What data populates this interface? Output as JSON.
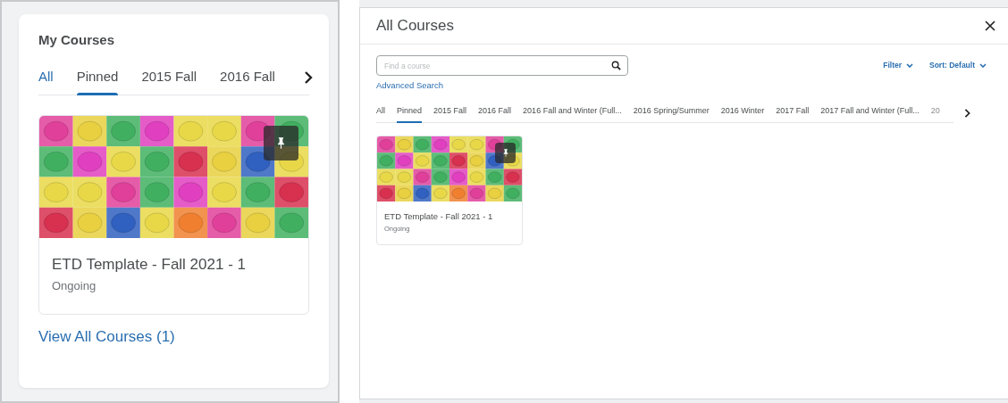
{
  "my_courses": {
    "title": "My Courses",
    "tabs": [
      {
        "label": "All",
        "selected": false,
        "hovered": true
      },
      {
        "label": "Pinned",
        "selected": true,
        "hovered": false
      },
      {
        "label": "2015 Fall",
        "selected": false,
        "hovered": false
      },
      {
        "label": "2016 Fall",
        "selected": false,
        "hovered": false
      }
    ],
    "courses": [
      {
        "name": "ETD Template - Fall 2021 - 1",
        "status": "Ongoing",
        "pinned": true
      }
    ],
    "view_all_link": "View All Courses (1)"
  },
  "all_courses": {
    "title": "All Courses",
    "search": {
      "placeholder": "Find a course"
    },
    "advanced_search": "Advanced Search",
    "filter": "Filter",
    "sort": "Sort: Default",
    "tabs": [
      {
        "label": "All",
        "selected": false
      },
      {
        "label": "Pinned",
        "selected": true
      },
      {
        "label": "2015 Fall",
        "selected": false
      },
      {
        "label": "2016 Fall",
        "selected": false
      },
      {
        "label": "2016 Fall and Winter (Full...",
        "selected": false
      },
      {
        "label": "2016 Spring/Summer",
        "selected": false
      },
      {
        "label": "2016 Winter",
        "selected": false
      },
      {
        "label": "2017 Fall",
        "selected": false
      },
      {
        "label": "2017 Fall and Winter (Full...",
        "selected": false
      },
      {
        "label": "20",
        "selected": false
      }
    ],
    "courses": [
      {
        "name": "ETD Template - Fall 2021 - 1",
        "status": "Ongoing",
        "pinned": true
      }
    ]
  }
}
